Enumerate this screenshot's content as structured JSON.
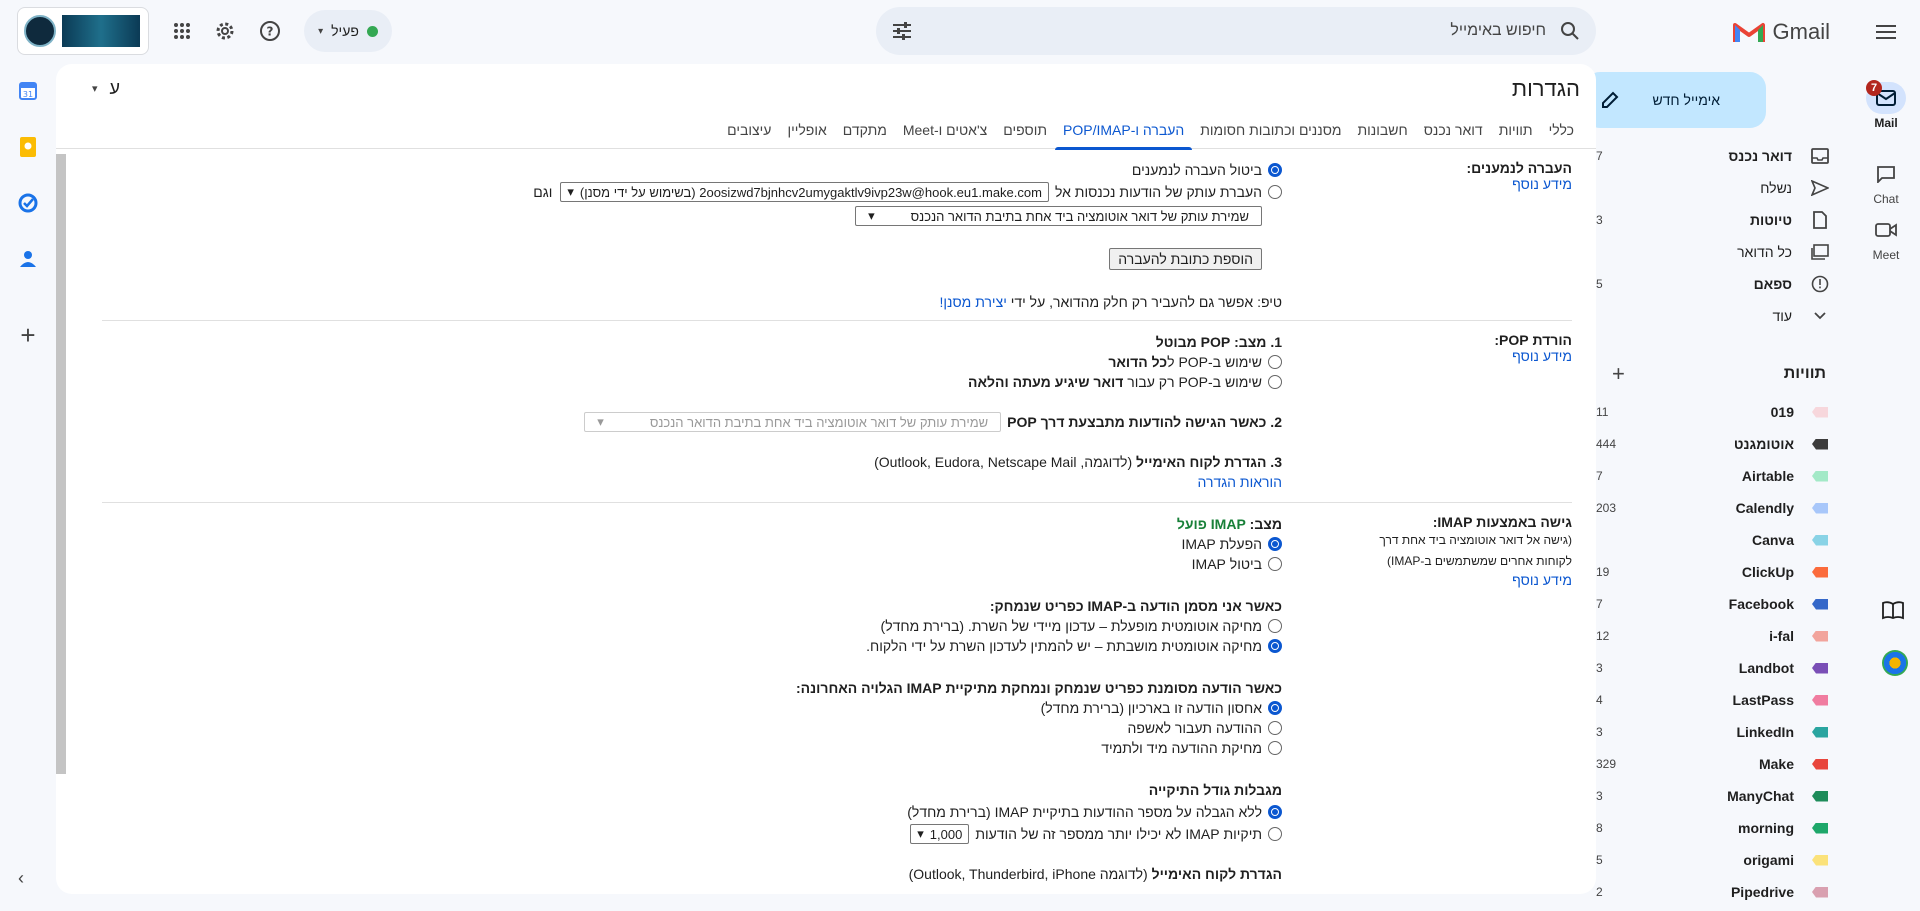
{
  "app": {
    "logo_text": "Gmail"
  },
  "rail": [
    {
      "label": "Mail",
      "icon": "mail-icon",
      "badge": "7"
    },
    {
      "label": "Chat",
      "icon": "chat-icon"
    },
    {
      "label": "Meet",
      "icon": "meet-icon"
    }
  ],
  "compose_label": "אימייל חדש",
  "nav": [
    {
      "label": "דואר נכנס",
      "count": "7",
      "bold": true,
      "icon": "inbox-icon"
    },
    {
      "label": "נשלח",
      "count": "",
      "bold": false,
      "icon": "send-icon"
    },
    {
      "label": "טיוטות",
      "count": "3",
      "bold": true,
      "icon": "draft-icon"
    },
    {
      "label": "כל הדואר",
      "count": "",
      "bold": false,
      "icon": "all-mail-icon"
    },
    {
      "label": "ספאם",
      "count": "5",
      "bold": true,
      "icon": "spam-icon"
    },
    {
      "label": "עוד",
      "count": "",
      "bold": false,
      "icon": "chevron-down-icon"
    }
  ],
  "labels_title": "תוויות",
  "labels": [
    {
      "name": "019",
      "count": "11",
      "color": "#f7d7dc"
    },
    {
      "name": "אוטומגנט",
      "count": "444",
      "color": "#3c3c3c"
    },
    {
      "name": "Airtable",
      "count": "7",
      "color": "#a3e9c7"
    },
    {
      "name": "Calendly",
      "count": "203",
      "color": "#a8c7fa"
    },
    {
      "name": "Canva",
      "count": "",
      "color": "#89d3e6"
    },
    {
      "name": "ClickUp",
      "count": "19",
      "color": "#fb6b3c"
    },
    {
      "name": "Facebook",
      "count": "7",
      "color": "#3568c9"
    },
    {
      "name": "i-fal",
      "count": "12",
      "color": "#f2a49c"
    },
    {
      "name": "Landbot",
      "count": "3",
      "color": "#7a4fb6"
    },
    {
      "name": "LastPass",
      "count": "4",
      "color": "#f07ca0"
    },
    {
      "name": "LinkedIn",
      "count": "3",
      "color": "#2aa5a0"
    },
    {
      "name": "Make",
      "count": "329",
      "color": "#e8453c"
    },
    {
      "name": "ManyChat",
      "count": "3",
      "color": "#1e8c5a"
    },
    {
      "name": "morning",
      "count": "8",
      "color": "#1ea76a"
    },
    {
      "name": "origami",
      "count": "5",
      "color": "#fbe27a"
    },
    {
      "name": "Pipedrive",
      "count": "2",
      "color": "#d9a0b0"
    }
  ],
  "search": {
    "placeholder": "חיפוש באימייל"
  },
  "status_label": "פעיל",
  "settings": {
    "title": "הגדרות",
    "lang_label": "ע",
    "tabs": [
      "כללי",
      "תוויות",
      "דואר נכנס",
      "חשבונות",
      "מסננים וכתובות חסומות",
      "העברה ו-POP/IMAP",
      "תוספים",
      "צ'אטים ו-Meet",
      "מתקדם",
      "אופליין",
      "עיצובים"
    ],
    "active_tab": 5,
    "forward": {
      "heading": "העברה לנמענים:",
      "more": "מידע נוסף",
      "opt_disable": "ביטול העברה לנמענים",
      "opt_forward_prefix": "העברת עותק של הודעות נכנסות אל",
      "forward_address": "2oosizwd7bjnhcv2umygaktlv9ivp23w@hook.eu1.make.com (בשימוש על ידי מסנן)",
      "and": "וגם",
      "keep_select": "שמירת עותק של דואר אוטומציה ביד אחת בתיבת הדואר הנכנס",
      "add_button": "הוספת כתובת להעברה",
      "tip_prefix": "טיפ: אפשר גם להעביר רק חלק מהדואר, על ידי",
      "tip_link": "יצירת מסנן!"
    },
    "pop": {
      "heading": "הורדת POP:",
      "more": "מידע נוסף",
      "status_prefix": "1. מצב:",
      "status_value": "POP מבוטל",
      "opt_all_prefix": "שימוש ב-POP ל",
      "opt_all_bold": "כל הדואר",
      "opt_new_prefix": "שימוש ב-POP רק עבור",
      "opt_new_bold": "דואר שיגיע מעתה והלאה",
      "when_access": "2. כאשר הגישה להודעות מתבצעת דרך POP",
      "when_select": "שמירת עותק של דואר אוטומציה ביד אחת בתיבת הדואר הנכנס",
      "client_bold": "3. הגדרת לקוח האימייל",
      "client_rest": "(לדוגמה, Outlook, Eudora, Netscape Mail)",
      "instructions": "הוראות הגדרה"
    },
    "imap": {
      "heading": "גישה באמצעות IMAP:",
      "sub": "(גישה אל דואר אוטומציה ביד אחת דרך לקוחות אחרים שמשתמשים ב-IMAP)",
      "more": "מידע נוסף",
      "status_prefix": "מצב:",
      "status_value": "IMAP פועל",
      "opt_enable": "הפעלת IMAP",
      "opt_disable": "ביטול IMAP",
      "deleted_heading": "כאשר אני מסמן הודעה ב-IMAP כפריט שנמחק:",
      "auto_on": "מחיקה אוטומטית מופעלת – עדכון מיידי של השרת. (ברירת מחדל)",
      "auto_off": "מחיקה אוטומטית מושבתת – יש להמתין לעדכון השרת על ידי הלקוח.",
      "expunge_heading": "כאשר הודעה מסומנת כפריט שנמחק ונמחקת מתיקיית IMAP הגלויה האחרונה:",
      "archive": "אחסון הודעה זו בארכיון (ברירת מחדל)",
      "trash": "ההודעה תעבור לאשפה",
      "delete_forever": "מחיקת ההודעה מיד ולתמיד",
      "size_heading": "מגבלות גודל התיקייה",
      "no_limit": "ללא הגבלה על מספר ההודעות בתיקיית IMAP (ברירת מחדל)",
      "limit_prefix": "תיקיות IMAP לא יכילו יותר ממספר זה של הודעות",
      "limit_value": "1,000",
      "client_bold": "הגדרת לקוח האימייל",
      "client_rest": "(לדוגמה Outlook, Thunderbird, iPhone)"
    }
  }
}
